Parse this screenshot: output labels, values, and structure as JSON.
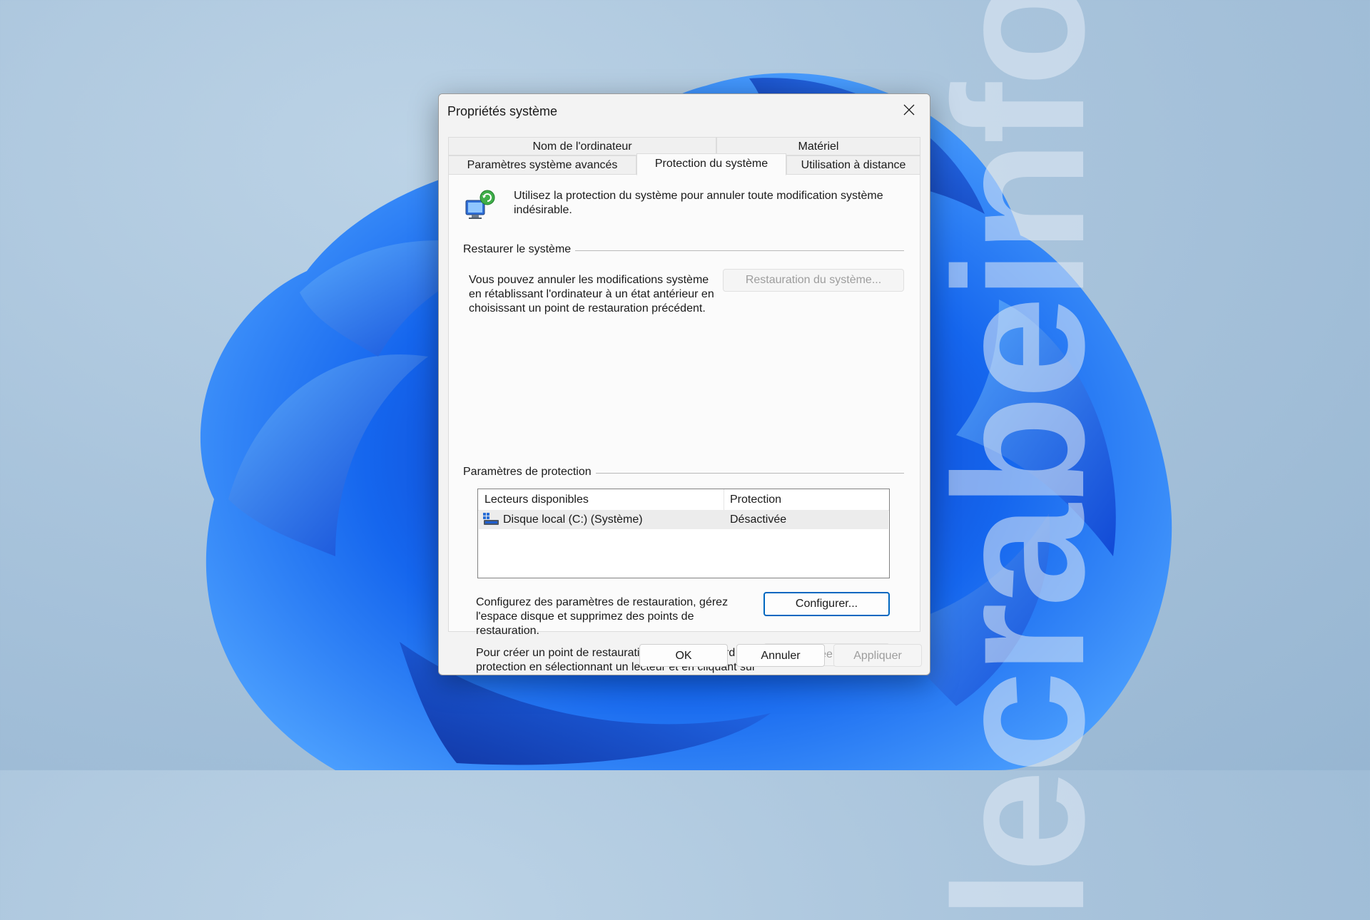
{
  "watermark": "lecrabeinfo",
  "dialog": {
    "title": "Propriétés système",
    "tabs_row1": [
      "Nom de l'ordinateur",
      "Matériel"
    ],
    "tabs_row2": [
      "Paramètres système avancés",
      "Protection du système",
      "Utilisation à distance"
    ],
    "active_tab": "Protection du système",
    "intro": "Utilisez la protection du système pour annuler toute modification système indésirable.",
    "restore_group": {
      "label": "Restaurer le système",
      "text": "Vous pouvez annuler les modifications système en rétablissant l'ordinateur à un état antérieur en choisissant un point de restauration précédent.",
      "button": "Restauration du système..."
    },
    "protection_group": {
      "label": "Paramètres de protection",
      "columns": [
        "Lecteurs disponibles",
        "Protection"
      ],
      "rows": [
        {
          "drive": "Disque local (C:) (Système)",
          "protection": "Désactivée",
          "icon": "drive-icon"
        }
      ],
      "configure_text": "Configurez des paramètres de restauration, gérez l'espace disque et supprimez des points de restauration.",
      "configure_button": "Configurer...",
      "create_text": "Pour créer un point de restauration, activez d'abord la protection en sélectionnant un lecteur et en cliquant sur Configurer.",
      "create_button": "Créer..."
    },
    "footer": {
      "ok": "OK",
      "cancel": "Annuler",
      "apply": "Appliquer"
    }
  },
  "colors": {
    "accent": "#0067c0",
    "wallpaper_blue": "#1a5ee6",
    "disabled_text": "#9d9d9d"
  }
}
